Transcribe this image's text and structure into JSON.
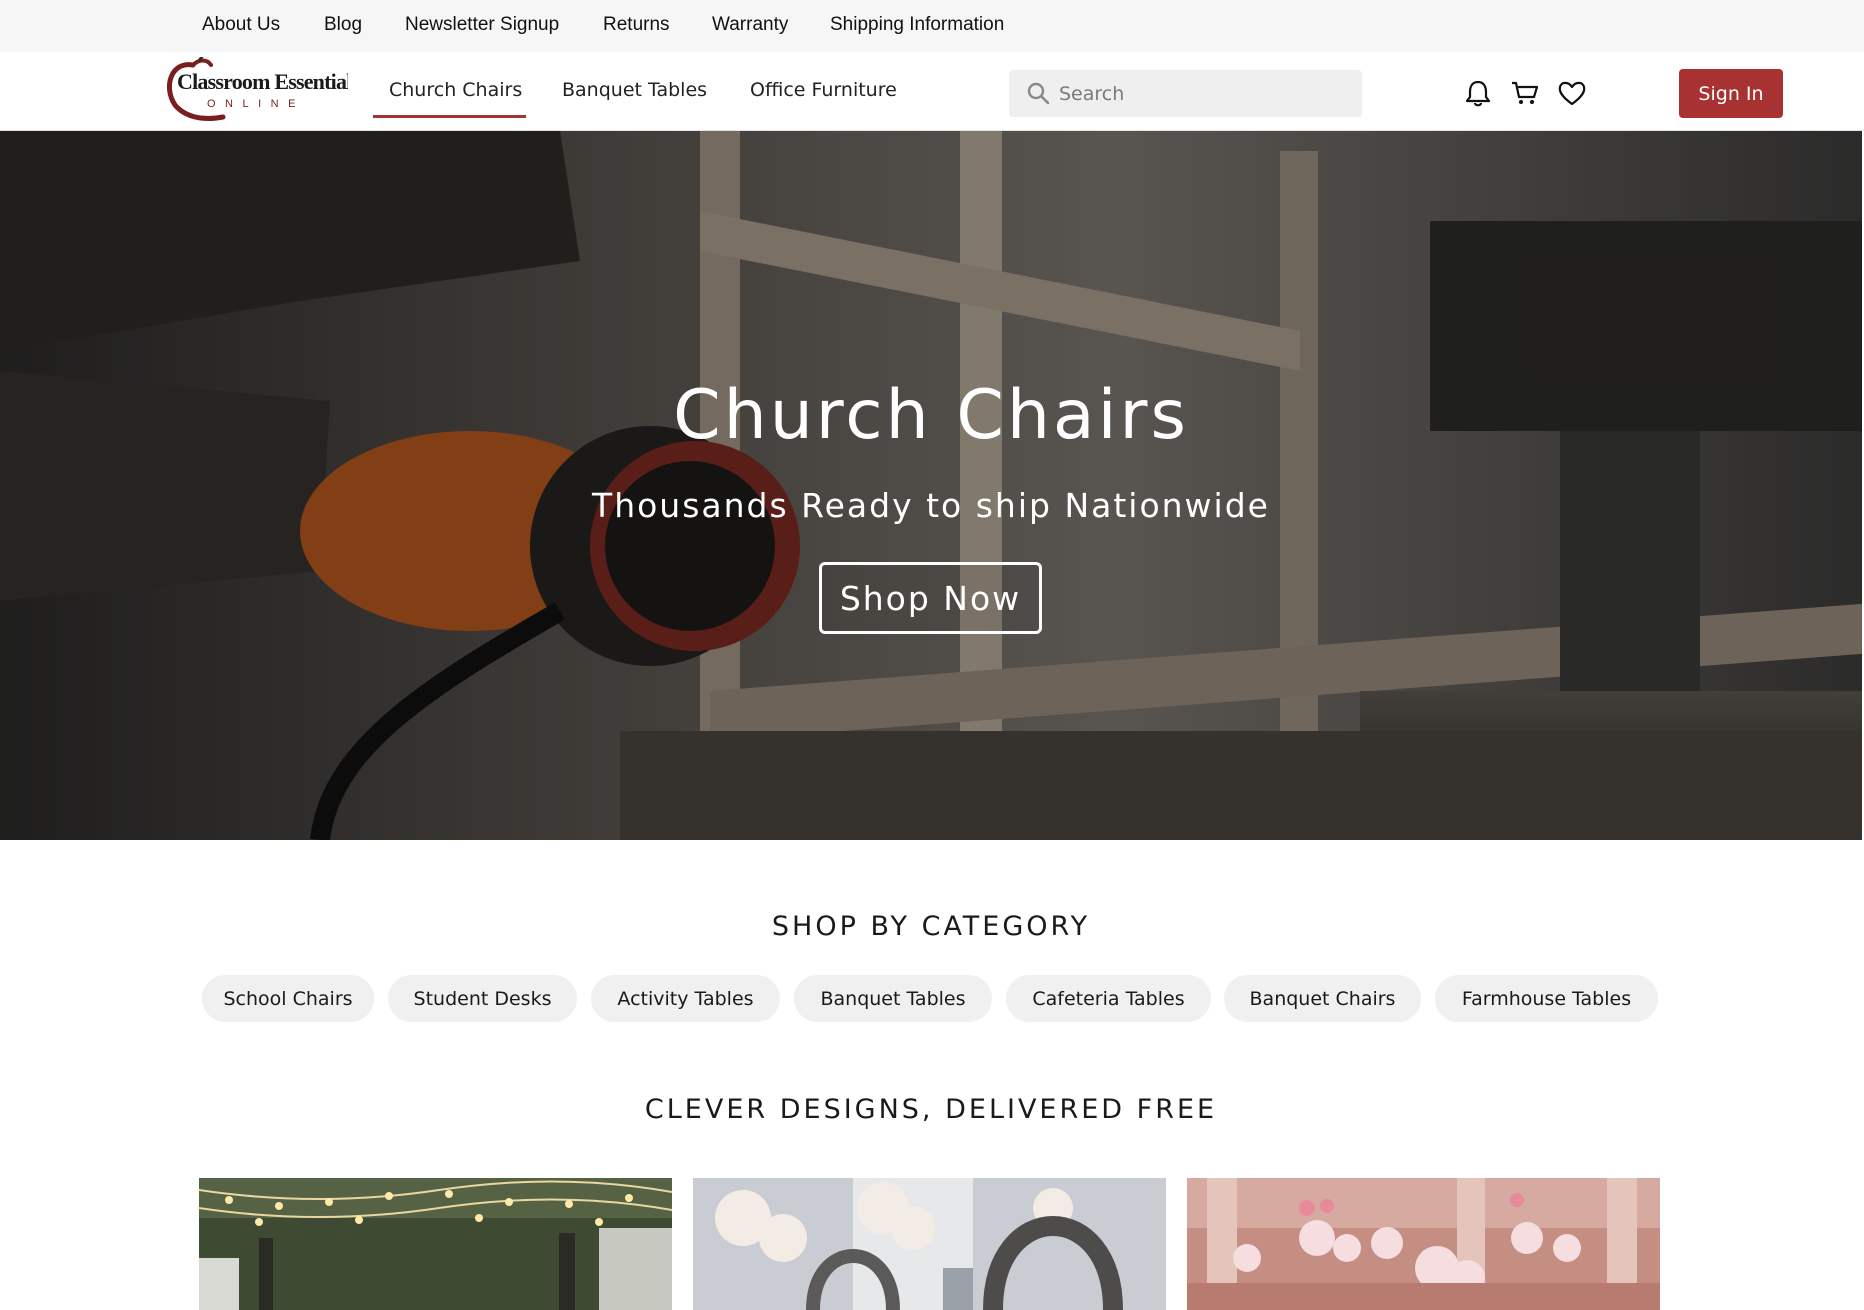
{
  "top_links": [
    "About Us",
    "Blog",
    "Newsletter Signup",
    "Returns",
    "Warranty",
    "Shipping Information"
  ],
  "logo": {
    "brand": "Classroom Essentials",
    "sub": "ONLINE",
    "color": "#7a1f1f"
  },
  "nav": {
    "items": [
      "Church Chairs",
      "Banquet Tables",
      "Office Furniture"
    ],
    "active": "Church Chairs"
  },
  "search": {
    "placeholder": "Search",
    "icon": "search-icon"
  },
  "header_icons": [
    "bell-icon",
    "cart-icon",
    "heart-icon"
  ],
  "sign_in_label": "Sign In",
  "accent_color": "#a83232",
  "hero": {
    "title": "Church Chairs",
    "subtitle": "Thousands Ready to ship Nationwide",
    "cta": "Shop Now"
  },
  "category_section": {
    "title": "SHOP BY CATEGORY",
    "pills": [
      "School Chairs",
      "Student Desks",
      "Activity Tables",
      "Banquet Tables",
      "Cafeteria Tables",
      "Banquet Chairs",
      "Farmhouse Tables"
    ]
  },
  "designs_section": {
    "title": "CLEVER DESIGNS, DELIVERED FREE"
  }
}
